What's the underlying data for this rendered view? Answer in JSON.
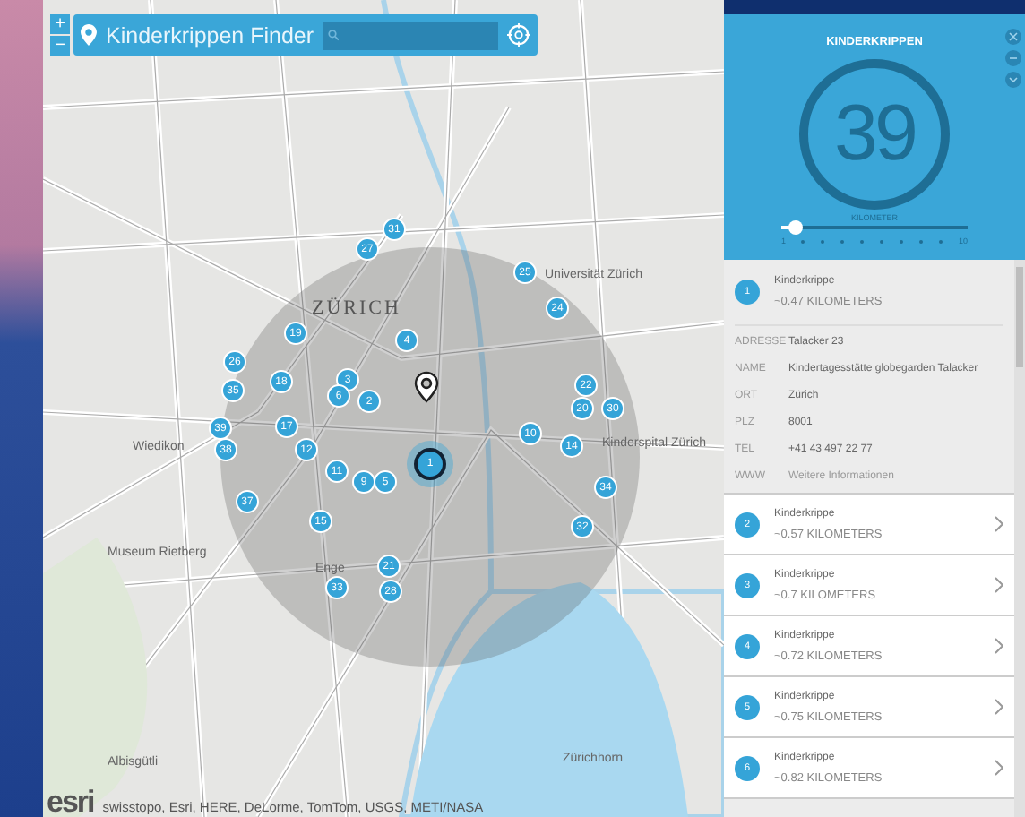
{
  "toolbar": {
    "zoom_in": "+",
    "zoom_out": "−",
    "title": "Kinderkrippen Finder"
  },
  "map": {
    "labels": [
      {
        "text": "ZÜRICH",
        "kind": "city"
      },
      {
        "text": "Wiedikon",
        "kind": "district"
      },
      {
        "text": "Enge",
        "kind": "district"
      },
      {
        "text": "Museum Rietberg",
        "kind": "place"
      },
      {
        "text": "Albisgütli",
        "kind": "place"
      },
      {
        "text": "Zürichhorn",
        "kind": "place"
      },
      {
        "text": "Universität Zürich",
        "kind": "place"
      },
      {
        "text": "Kinderspital Zürich",
        "kind": "place"
      }
    ],
    "markers": [
      {
        "label": "31",
        "selected": false
      },
      {
        "label": "27",
        "selected": false
      },
      {
        "label": "25",
        "selected": false
      },
      {
        "label": "24",
        "selected": false
      },
      {
        "label": "19",
        "selected": false
      },
      {
        "label": "4",
        "selected": false
      },
      {
        "label": "26",
        "selected": false
      },
      {
        "label": "35",
        "selected": false
      },
      {
        "label": "18",
        "selected": false
      },
      {
        "label": "3",
        "selected": false
      },
      {
        "label": "6",
        "selected": false
      },
      {
        "label": "2",
        "selected": false
      },
      {
        "label": "22",
        "selected": false
      },
      {
        "label": "20",
        "selected": false
      },
      {
        "label": "30",
        "selected": false
      },
      {
        "label": "39",
        "selected": false
      },
      {
        "label": "38",
        "selected": false
      },
      {
        "label": "17",
        "selected": false
      },
      {
        "label": "10",
        "selected": false
      },
      {
        "label": "14",
        "selected": false
      },
      {
        "label": "12",
        "selected": false
      },
      {
        "label": "11",
        "selected": false
      },
      {
        "label": "9",
        "selected": false
      },
      {
        "label": "5",
        "selected": false
      },
      {
        "label": "1",
        "selected": true
      },
      {
        "label": "34",
        "selected": false
      },
      {
        "label": "37",
        "selected": false
      },
      {
        "label": "15",
        "selected": false
      },
      {
        "label": "32",
        "selected": false
      },
      {
        "label": "21",
        "selected": false
      },
      {
        "label": "33",
        "selected": false
      },
      {
        "label": "28",
        "selected": false
      }
    ],
    "attribution": "swisstopo, Esri, HERE, DeLorme, TomTom, USGS, METI/NASA",
    "logo": "esri"
  },
  "panel": {
    "title": "KINDERKRIPPEN",
    "count": "39",
    "slider": {
      "label": "KILOMETER",
      "level": 0.08,
      "min_label": "1",
      "max_label": "10"
    },
    "items": [
      {
        "number": "1",
        "name": "Kinderkrippe",
        "distance": "~0.47 KILOMETERS",
        "expanded": true,
        "details": [
          {
            "key": "ADRESSE",
            "value": "Talacker 23",
            "kind": "text"
          },
          {
            "key": "NAME",
            "value": "Kindertagesstätte globegarden Talacker",
            "kind": "text"
          },
          {
            "key": "ORT",
            "value": "Zürich",
            "kind": "text"
          },
          {
            "key": "PLZ",
            "value": "8001",
            "kind": "text"
          },
          {
            "key": "TEL",
            "value": "+41 43 497 22 77",
            "kind": "text"
          },
          {
            "key": "WWW",
            "value": "Weitere Informationen",
            "kind": "link"
          }
        ]
      },
      {
        "number": "2",
        "name": "Kinderkrippe",
        "distance": "~0.57 KILOMETERS",
        "expanded": false
      },
      {
        "number": "3",
        "name": "Kinderkrippe",
        "distance": "~0.7 KILOMETERS",
        "expanded": false
      },
      {
        "number": "4",
        "name": "Kinderkrippe",
        "distance": "~0.72 KILOMETERS",
        "expanded": false
      },
      {
        "number": "5",
        "name": "Kinderkrippe",
        "distance": "~0.75 KILOMETERS",
        "expanded": false
      },
      {
        "number": "6",
        "name": "Kinderkrippe",
        "distance": "~0.82 KILOMETERS",
        "expanded": false
      }
    ]
  }
}
